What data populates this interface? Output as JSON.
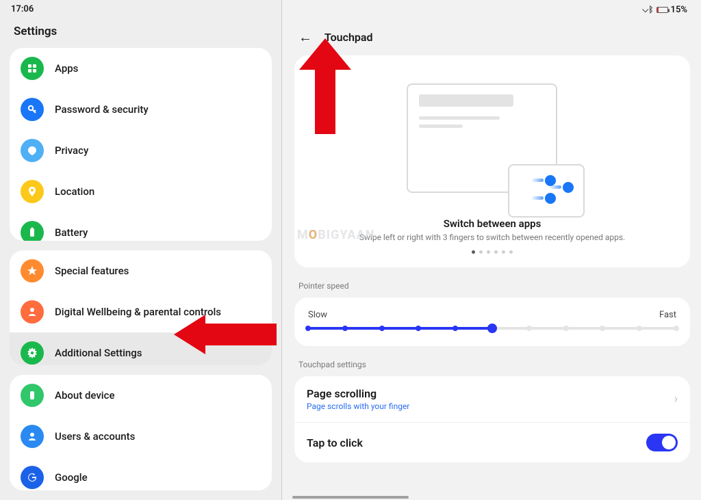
{
  "status": {
    "time": "17:06",
    "battery_text": "15%"
  },
  "left": {
    "title": "Settings",
    "group1": [
      {
        "label": "Apps"
      },
      {
        "label": "Password & security"
      },
      {
        "label": "Privacy"
      },
      {
        "label": "Location"
      },
      {
        "label": "Battery"
      }
    ],
    "group2": [
      {
        "label": "Special features"
      },
      {
        "label": "Digital Wellbeing & parental controls"
      },
      {
        "label": "Additional Settings"
      }
    ],
    "group3": [
      {
        "label": "About device"
      },
      {
        "label": "Users & accounts"
      },
      {
        "label": "Google"
      }
    ]
  },
  "right": {
    "header": "Touchpad",
    "hero": {
      "title": "Switch between apps",
      "desc": "Swipe left or right with 3 fingers to switch between recently opened apps.",
      "active_dot": 0,
      "dot_count": 6
    },
    "watermark": {
      "pre": "M",
      "o": "O",
      "post": "BIGYAAN"
    },
    "pointer_section_label": "Pointer speed",
    "pointer": {
      "min_label": "Slow",
      "max_label": "Fast",
      "ticks": 11,
      "value_index": 5
    },
    "touchpad_section_label": "Touchpad settings",
    "settings": {
      "page_scrolling": {
        "title": "Page scrolling",
        "sub": "Page scrolls with your finger"
      },
      "tap_to_click": {
        "title": "Tap to click",
        "on": true
      }
    }
  }
}
